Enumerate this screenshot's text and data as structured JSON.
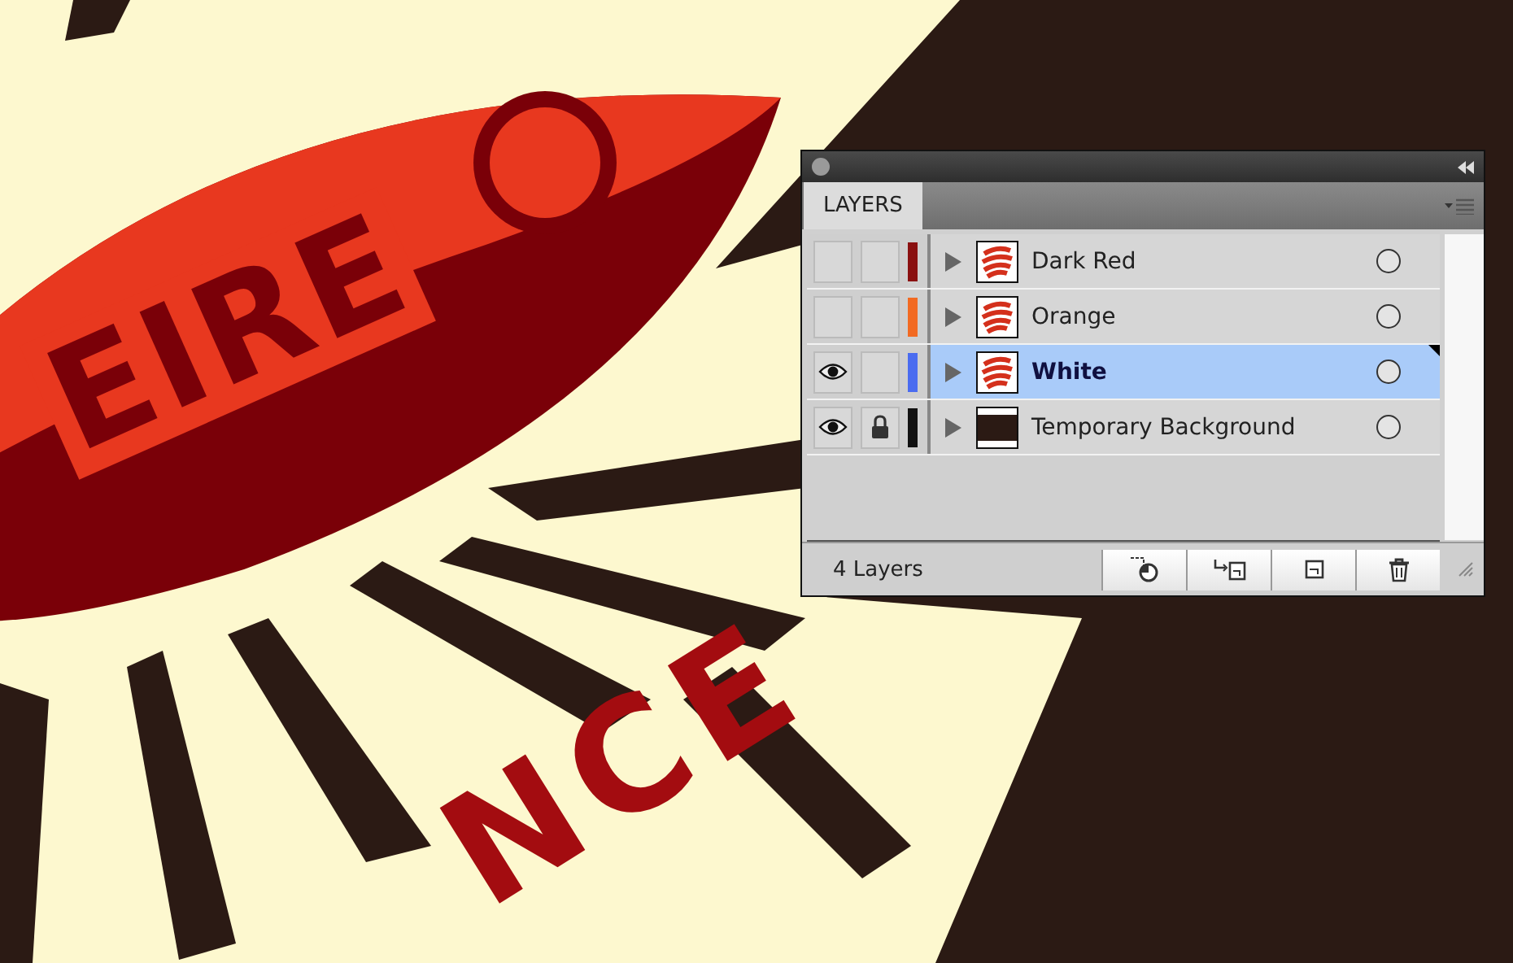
{
  "artwork": {
    "lettering": [
      {
        "text": "EIRE"
      },
      {
        "text": "NCE"
      }
    ]
  },
  "panel": {
    "tab": "LAYERS",
    "layers": [
      {
        "name": "Dark Red",
        "kind": "art",
        "visible": false,
        "locked": false,
        "color": "#8a1010",
        "selected": false
      },
      {
        "name": "Orange",
        "kind": "art",
        "visible": false,
        "locked": false,
        "color": "#f26a22",
        "selected": false
      },
      {
        "name": "White",
        "kind": "art",
        "visible": true,
        "locked": false,
        "color": "#4a6cf0",
        "selected": true
      },
      {
        "name": "Temporary Background",
        "kind": "background",
        "visible": true,
        "locked": true,
        "color": "#111111",
        "selected": false
      }
    ],
    "footer": {
      "count": "4 Layers"
    }
  }
}
